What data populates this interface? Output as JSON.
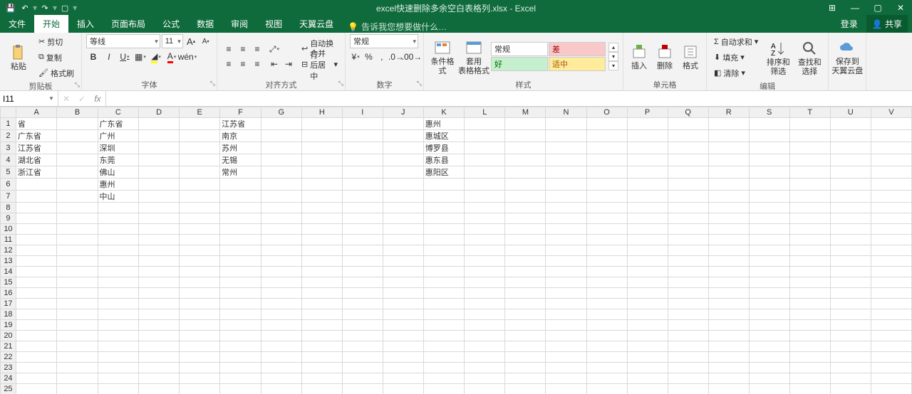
{
  "qat": {
    "save": "💾",
    "undo": "↶",
    "redo": "↷",
    "new": "▢"
  },
  "title": "excel快速删除多余空白表格列.xlsx - Excel",
  "windowButtons": {
    "ribbonOpts": "⊞",
    "min": "—",
    "max": "▢",
    "close": "✕"
  },
  "tabs": {
    "file": "文件",
    "home": "开始",
    "insert": "插入",
    "pageLayout": "页面布局",
    "formulas": "公式",
    "data": "数据",
    "review": "审阅",
    "view": "视图",
    "tianyi": "天翼云盘",
    "tellme": "告诉我您想要做什么…",
    "login": "登录",
    "share": "共享"
  },
  "ribbon": {
    "clipboard": {
      "label": "剪贴板",
      "paste": "粘贴",
      "cut": "剪切",
      "copy": "复制",
      "formatPainter": "格式刷"
    },
    "font": {
      "label": "字体",
      "name": "等线",
      "size": "11",
      "increase": "A",
      "decrease": "A",
      "bold": "B",
      "italic": "I",
      "underline": "U"
    },
    "alignment": {
      "label": "对齐方式",
      "wrap": "自动换行",
      "merge": "合并后居中"
    },
    "number": {
      "label": "数字",
      "format": "常规"
    },
    "styles": {
      "label": "样式",
      "condfmt": "条件格式",
      "table": "套用\n表格格式",
      "cell": "样式",
      "normal": "常规",
      "bad": "差",
      "good": "好",
      "neutral": "适中"
    },
    "cells": {
      "label": "单元格",
      "insert": "插入",
      "delete": "删除",
      "format": "格式"
    },
    "editing": {
      "label": "编辑",
      "autosum": "自动求和",
      "fill": "填充",
      "clear": "清除",
      "sortfilter": "排序和筛选",
      "find": "查找和选择"
    },
    "save": {
      "label": "",
      "saveto": "保存到\n天翼云盘"
    }
  },
  "nameBox": "I11",
  "formula": "",
  "columns": [
    "A",
    "B",
    "C",
    "D",
    "E",
    "F",
    "G",
    "H",
    "I",
    "J",
    "K",
    "L",
    "M",
    "N",
    "O",
    "P",
    "Q",
    "R",
    "S",
    "T",
    "U",
    "V"
  ],
  "rowCount": 25,
  "cells": {
    "A1": "省",
    "C1": "广东省",
    "F1": "江苏省",
    "K1": "惠州",
    "A2": "广东省",
    "C2": "广州",
    "F2": "南京",
    "K2": "惠城区",
    "A3": "江苏省",
    "C3": "深圳",
    "F3": "苏州",
    "K3": "博罗县",
    "A4": "湖北省",
    "C4": "东莞",
    "F4": "无锡",
    "K4": "惠东县",
    "A5": "浙江省",
    "C5": "佛山",
    "F5": "常州",
    "K5": "惠阳区",
    "C6": "惠州",
    "C7": "中山"
  }
}
